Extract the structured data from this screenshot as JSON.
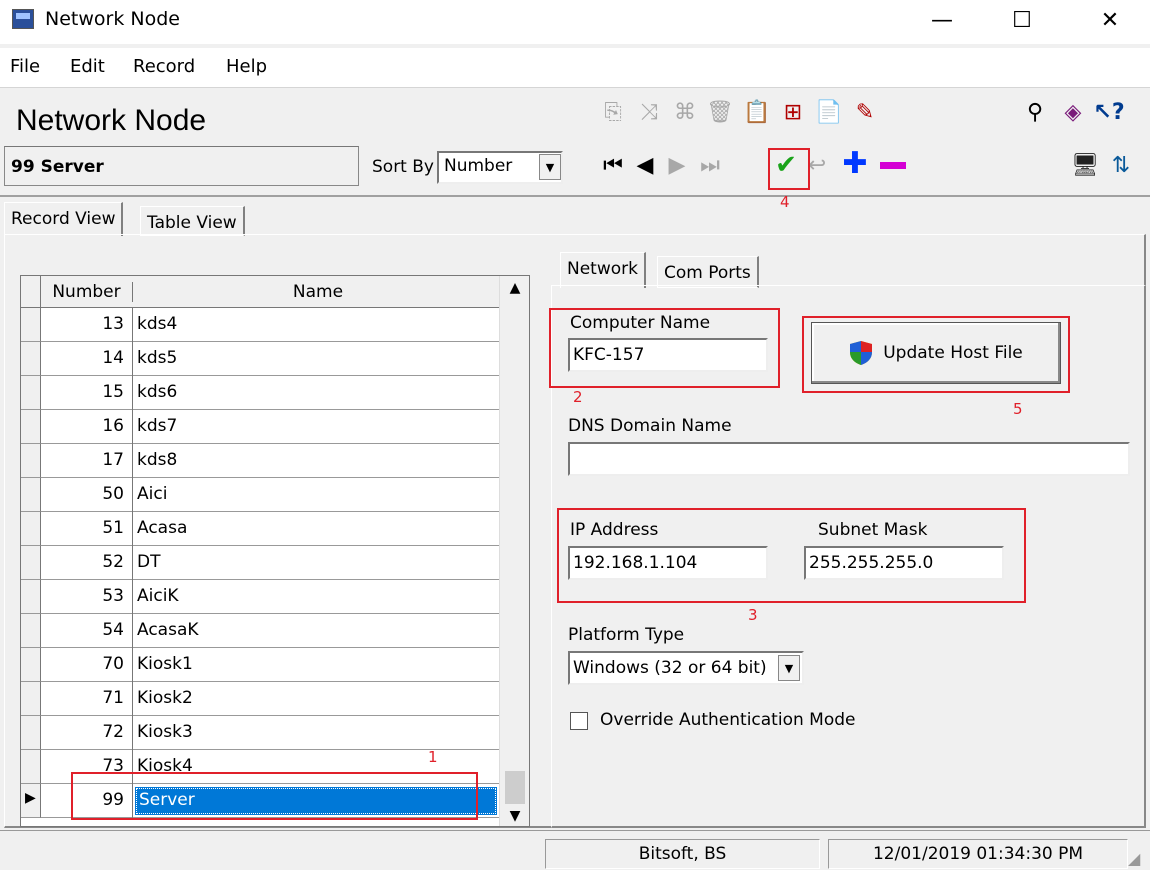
{
  "window": {
    "title": "Network Node",
    "minimize": "—",
    "maximize": "☐",
    "close": "✕"
  },
  "menu": [
    "File",
    "Edit",
    "Record",
    "Help"
  ],
  "header": {
    "title": "Network Node",
    "record": "99 Server",
    "sort_label": "Sort By",
    "sort_value": "Number"
  },
  "tabs": [
    "Record View",
    "Table View"
  ],
  "grid": {
    "columns": [
      "Number",
      "Name"
    ],
    "rows": [
      {
        "number": "13",
        "name": "kds4"
      },
      {
        "number": "14",
        "name": "kds5"
      },
      {
        "number": "15",
        "name": "kds6"
      },
      {
        "number": "16",
        "name": "kds7"
      },
      {
        "number": "17",
        "name": "kds8"
      },
      {
        "number": "50",
        "name": "Aici"
      },
      {
        "number": "51",
        "name": "Acasa"
      },
      {
        "number": "52",
        "name": "DT"
      },
      {
        "number": "53",
        "name": "AiciK"
      },
      {
        "number": "54",
        "name": "AcasaK"
      },
      {
        "number": "70",
        "name": "Kiosk1"
      },
      {
        "number": "71",
        "name": "Kiosk2"
      },
      {
        "number": "72",
        "name": "Kiosk3"
      },
      {
        "number": "73",
        "name": "Kiosk4"
      },
      {
        "number": "99",
        "name": "Server"
      }
    ],
    "selected_row": "99"
  },
  "detail_tabs": [
    "Network",
    "Com Ports"
  ],
  "form": {
    "computer_name_label": "Computer Name",
    "computer_name": "KFC-157",
    "update_button": "Update Host File",
    "dns_label": "DNS Domain Name",
    "dns_value": "",
    "ip_label": "IP Address",
    "ip_value": "192.168.1.104",
    "subnet_label": "Subnet Mask",
    "subnet_value": "255.255.255.0",
    "platform_label": "Platform Type",
    "platform_value": "Windows (32 or 64 bit)",
    "override_label": "Override Authentication Mode",
    "override_checked": false
  },
  "annotations": [
    "1",
    "2",
    "3",
    "4",
    "5"
  ],
  "status": {
    "user": "Bitsoft, BS",
    "datetime": "12/01/2019 01:34:30 PM"
  },
  "colors": {
    "selection": "#0078d7",
    "annotation": "#e0202a",
    "save": "#1aa31a",
    "add": "#0038ff",
    "remove": "#d400d4"
  },
  "icons": [
    "copy-icon",
    "paste-special-icon",
    "network-icon",
    "trash-icon",
    "report-icon",
    "compare-icon",
    "clipboard-icon",
    "eraser-icon",
    "binoculars-icon",
    "book-icon",
    "help-pointer-icon",
    "first-record-icon",
    "prev-record-icon",
    "next-record-icon",
    "last-record-icon",
    "save-check-icon",
    "undo-icon",
    "add-plus-icon",
    "remove-minus-icon",
    "screen-icon",
    "transfer-icon",
    "shield-icon"
  ]
}
